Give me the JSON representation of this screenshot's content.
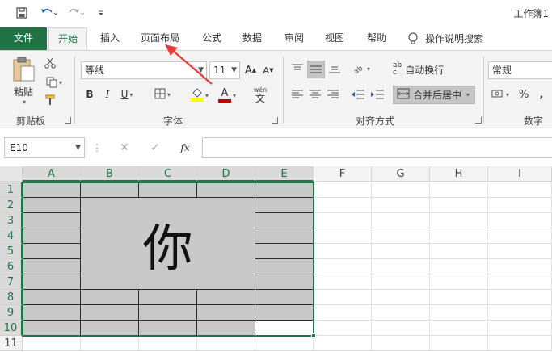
{
  "quick_access": {
    "save_icon": "save-icon",
    "undo_icon": "undo-icon",
    "redo_icon": "redo-icon",
    "customize_icon": "customize-qat-icon"
  },
  "window": {
    "title": "工作簿1"
  },
  "tabs": [
    {
      "label": "文件"
    },
    {
      "label": "开始"
    },
    {
      "label": "插入"
    },
    {
      "label": "页面布局"
    },
    {
      "label": "公式"
    },
    {
      "label": "数据"
    },
    {
      "label": "审阅"
    },
    {
      "label": "视图"
    },
    {
      "label": "帮助"
    }
  ],
  "tell_me": {
    "label": "操作说明搜索",
    "icon": "lightbulb-icon"
  },
  "clipboard": {
    "paste_label": "粘贴",
    "group_label": "剪贴板"
  },
  "font": {
    "font_name": "等线",
    "font_size": "11",
    "bold": "B",
    "italic": "I",
    "underline": "U",
    "font_color_letter": "A",
    "grow_letter": "A",
    "shrink_letter": "A",
    "wen_label": "wén",
    "wen_char": "文",
    "group_label": "字体",
    "highlight_color": "#ffff00",
    "font_color": "#c00000"
  },
  "alignment": {
    "wrap_text_label": "自动换行",
    "merge_center_label": "合并后居中",
    "group_label": "对齐方式",
    "wrap_prefix": "ab",
    "wrap_char": "c"
  },
  "number": {
    "format_value": "常规",
    "percent": "%",
    "comma": ",",
    "group_label": "数字"
  },
  "formula_bar": {
    "name_box": "E10",
    "fx_label": "fx",
    "value": ""
  },
  "sheet": {
    "columns": [
      "A",
      "B",
      "C",
      "D",
      "E",
      "F",
      "G",
      "H",
      "I"
    ],
    "rows": [
      "1",
      "2",
      "3",
      "4",
      "5",
      "6",
      "7",
      "8",
      "9",
      "10",
      "11"
    ],
    "merged_cell_text": "你",
    "active_cell": "E10"
  },
  "colors": {
    "accent": "#217346",
    "cell_fill": "#c8c8c8",
    "annotation_arrow": "#e83a3a"
  }
}
